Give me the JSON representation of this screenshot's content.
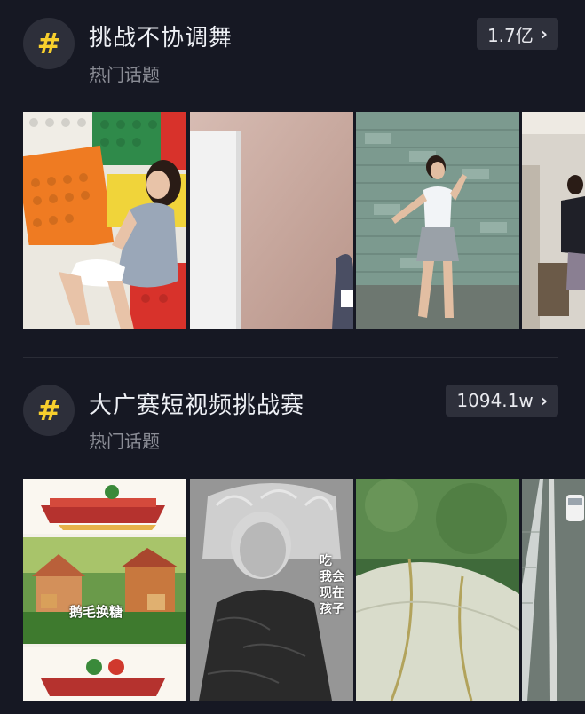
{
  "topics": [
    {
      "title": "挑战不协调舞",
      "subtitle": "热门话题",
      "count": "1.7亿",
      "hash_symbol": "#",
      "thumbnails": [
        {
          "label": "lego-wall-dancer"
        },
        {
          "label": "door-room-dancer"
        },
        {
          "label": "brick-wall-dancer"
        },
        {
          "label": "indoor-dancer"
        }
      ]
    },
    {
      "title": "大广赛短视频挑战赛",
      "subtitle": "热门话题",
      "count": "1094.1w",
      "hash_symbol": "#",
      "thumbnails": [
        {
          "label": "ad-animation-collage",
          "caption": "鹅毛换糖"
        },
        {
          "label": "elderly-woman-video",
          "overlay_lines": [
            "吃",
            "我会",
            "现在",
            "孩子"
          ]
        },
        {
          "label": "umbrella-closeup"
        },
        {
          "label": "highway-car"
        }
      ]
    }
  ],
  "colors": {
    "background": "#161823",
    "accent": "#f7cf2d",
    "pill_bg": "#2e303b",
    "subtle_text": "#8a8c95"
  },
  "icons": {
    "hash": "hashtag-icon",
    "chevron": "chevron-right-icon"
  }
}
